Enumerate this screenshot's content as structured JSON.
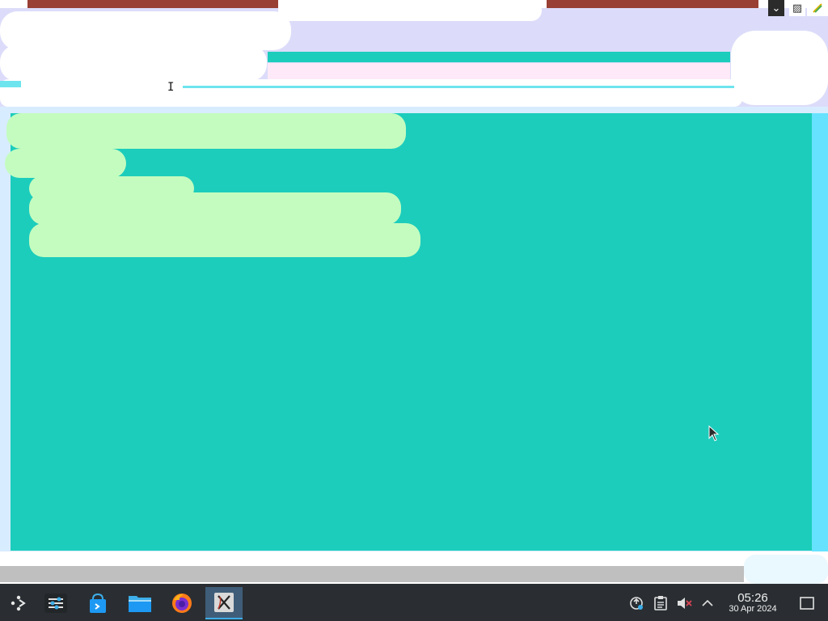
{
  "window": {
    "controls": [
      {
        "name": "chevron-down-icon",
        "glyph": "⌄"
      },
      {
        "name": "network-hatch-icon",
        "glyph": "▨"
      }
    ]
  },
  "toolbar": {
    "progress": 1.0,
    "cursor_glyph": "I"
  },
  "colors": {
    "content": "#1ccdbc",
    "header": "#dcdcfa",
    "taskbar": "#2a2e32",
    "accent": "#3daee9"
  },
  "taskbar": {
    "apps": [
      {
        "name": "application-launcher-icon"
      },
      {
        "name": "system-settings-icon"
      },
      {
        "name": "discover-store-icon"
      },
      {
        "name": "file-manager-icon"
      },
      {
        "name": "firefox-icon"
      },
      {
        "name": "x-app-icon",
        "active": true
      }
    ],
    "tray": [
      {
        "name": "network-status-icon"
      },
      {
        "name": "clipboard-icon"
      },
      {
        "name": "volume-muted-icon"
      },
      {
        "name": "tray-expand-chevron-icon"
      }
    ],
    "clock": {
      "time": "05:26",
      "date": "30 Apr 2024"
    }
  }
}
